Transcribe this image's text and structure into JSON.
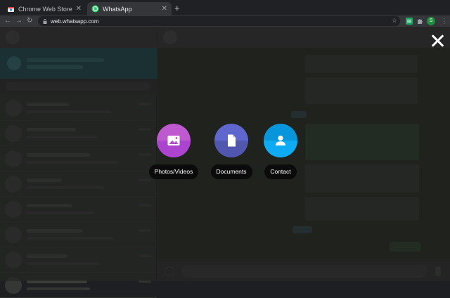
{
  "browser": {
    "tabs": [
      {
        "title": "Chrome Web Store - Extension",
        "close": "✕"
      },
      {
        "title": "WhatsApp",
        "close": "✕"
      }
    ],
    "new_tab": "+",
    "nav": {
      "back": "←",
      "forward": "→",
      "reload": "↻"
    },
    "url": "web.whatsapp.com",
    "bookmark_star": "☆",
    "profile_initial": "S",
    "menu": "⋮"
  },
  "overlay": {
    "options": [
      {
        "label": "Photos/Videos",
        "color": "#bf59cf",
        "shade": "#ac44cf",
        "icon": "image-icon"
      },
      {
        "label": "Documents",
        "color": "#5f66cd",
        "shade": "#5157ae",
        "icon": "document-icon"
      },
      {
        "label": "Contact",
        "color": "#0795dc",
        "shade": "#0eabf4",
        "icon": "person-icon"
      }
    ],
    "close_icon": "close-icon"
  }
}
